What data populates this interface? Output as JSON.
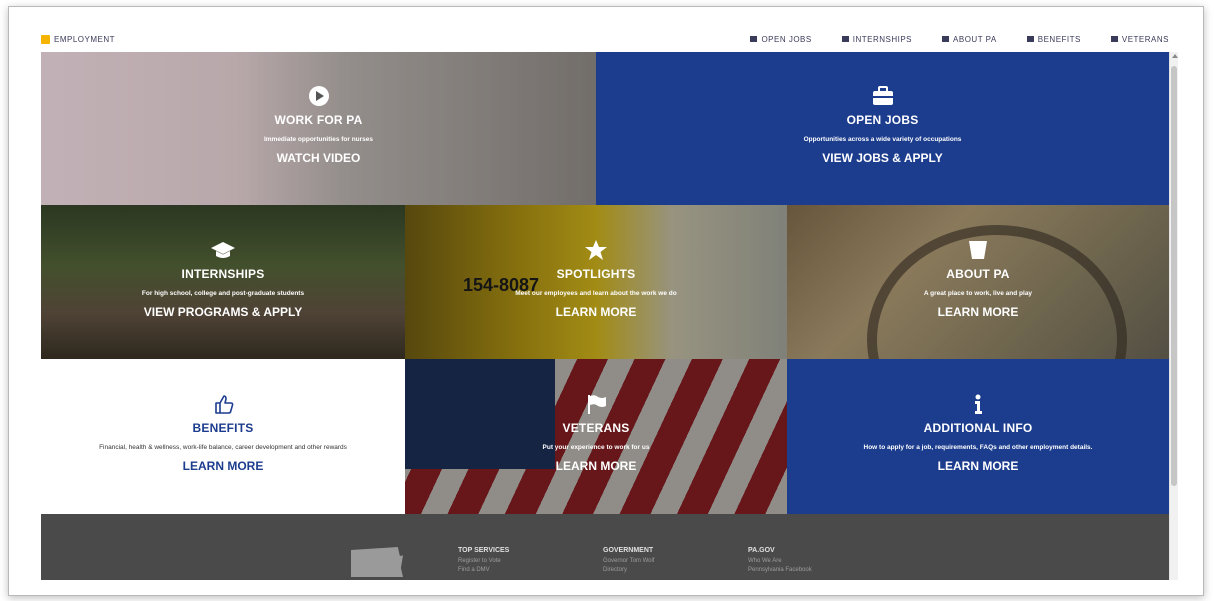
{
  "header": {
    "brand": "EMPLOYMENT",
    "nav": [
      {
        "label": "OPEN JOBS",
        "icon": "briefcase-icon"
      },
      {
        "label": "INTERNSHIPS",
        "icon": "graduation-cap-icon"
      },
      {
        "label": "ABOUT PA",
        "icon": "keystone-icon"
      },
      {
        "label": "BENEFITS",
        "icon": "thumbs-up-icon"
      },
      {
        "label": "VETERANS",
        "icon": "flag-icon"
      }
    ]
  },
  "tiles": {
    "work": {
      "title": "WORK FOR PA",
      "sub": "Immediate opportunities for nurses",
      "cta": "WATCH VIDEO",
      "icon": "play-icon"
    },
    "openjobs": {
      "title": "OPEN JOBS",
      "sub": "Opportunities across a wide variety of occupations",
      "cta": "VIEW JOBS & APPLY",
      "icon": "briefcase-icon"
    },
    "internships": {
      "title": "INTERNSHIPS",
      "sub": "For high school, college and post-graduate students",
      "cta": "VIEW PROGRAMS & APPLY",
      "icon": "graduation-cap-icon"
    },
    "spotlights": {
      "title": "SPOTLIGHTS",
      "sub": "Meet our employees and learn about the work we do",
      "cta": "LEARN MORE",
      "icon": "star-icon",
      "truck_number": "154-8087"
    },
    "aboutpa": {
      "title": "ABOUT PA",
      "sub": "A great place to work, live and play",
      "cta": "LEARN MORE",
      "icon": "keystone-icon"
    },
    "benefits": {
      "title": "BENEFITS",
      "sub": "Financial, health & wellness, work-life balance, career development and other rewards",
      "cta": "LEARN MORE",
      "icon": "thumbs-up-icon"
    },
    "veterans": {
      "title": "VETERANS",
      "sub": "Put your experience to work for us",
      "cta": "LEARN MORE",
      "icon": "flag-icon"
    },
    "additional": {
      "title": "ADDITIONAL INFO",
      "sub": "How to apply for a job, requirements, FAQs and other employment details.",
      "cta": "LEARN MORE",
      "icon": "info-icon"
    }
  },
  "footer": {
    "columns": [
      {
        "head": "TOP SERVICES",
        "links": [
          "Register to Vote",
          "Find a DMV"
        ]
      },
      {
        "head": "GOVERNMENT",
        "links": [
          "Governor Tom Wolf",
          "Directory"
        ]
      },
      {
        "head": "PA.GOV",
        "links": [
          "Who We Are",
          "Pennsylvania Facebook"
        ]
      }
    ]
  },
  "colors": {
    "brand_blue": "#1c3d8e",
    "footer_gray": "#4a4a4a"
  }
}
